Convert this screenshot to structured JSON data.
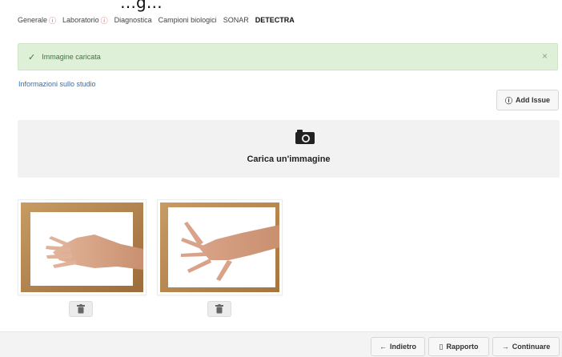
{
  "header_partial": "…g…",
  "tabs": [
    {
      "label": "Generale",
      "warning": true
    },
    {
      "label": "Laboratorio",
      "warning": true
    },
    {
      "label": "Diagnostica",
      "warning": false
    },
    {
      "label": "Campioni biologici",
      "warning": false
    },
    {
      "label": "SONAR",
      "warning": false
    },
    {
      "label": "DETECTRA",
      "warning": false,
      "active": true
    }
  ],
  "alert": {
    "message": "Immagine caricata",
    "close": "×"
  },
  "study_link": "Informazioni sullo studio",
  "add_issue": {
    "label": "Add Issue"
  },
  "upload": {
    "label": "Carica un'immagine"
  },
  "images": [
    {
      "alt": "hand-photo-1"
    },
    {
      "alt": "hand-photo-2"
    }
  ],
  "footer": {
    "back_label": "Indietro",
    "report_label": "Rapporto",
    "continue_label": "Continuare"
  },
  "colors": {
    "alert_bg": "#dff0d8",
    "alert_text": "#3c763d",
    "link": "#2f6fb6",
    "warning": "#d9534f"
  }
}
